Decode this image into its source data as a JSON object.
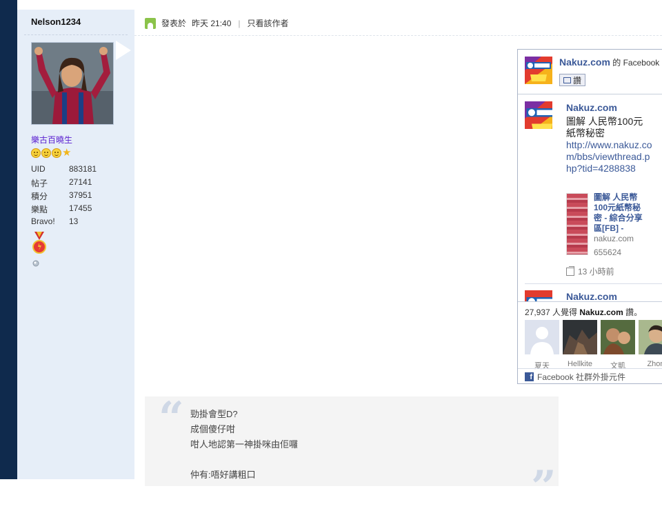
{
  "user": {
    "name": "Nelson1234",
    "group": "樂古百曉生",
    "stats": [
      {
        "label": "UID",
        "value": "883181"
      },
      {
        "label": "帖子",
        "value": "27141"
      },
      {
        "label": "積分",
        "value": "37951"
      },
      {
        "label": "樂點",
        "value": "17455"
      },
      {
        "label": "Bravo!",
        "value": "13"
      }
    ]
  },
  "post": {
    "posted_label": "發表於",
    "posted_time": "昨天 21:40",
    "only_author": "只看該作者"
  },
  "facebook": {
    "page_name": "Nakuz.com",
    "header_suffix": "的 Facebook",
    "like_button": "讚",
    "feed_name": "Nakuz.com",
    "feed_text": "圖解 人民幣100元紙幣秘密",
    "feed_link": "http://www.nakuz.com/bbs/viewthread.php?tid=4288838",
    "attachment_title": "圖解 人民幣100元紙幣秘密 - 綜合分享區[FB] -",
    "attachment_domain": "nakuz.com",
    "attachment_number": "655624",
    "feed_time": "13 小時前",
    "feed_name_2": "Nakuz.com",
    "likers_prefix": "27,937 人覺得",
    "likers_page": "Nakuz.com",
    "likers_suffix": "讚。",
    "faces": [
      "夏天",
      "Hellkite",
      "文凱",
      "Zhon"
    ],
    "footer": "Facebook 社群外掛元件"
  },
  "quote": {
    "lines": [
      "勁掛會型D?",
      "成個傻仔咁",
      "咁人地認第一神掛咪由佢囉",
      "",
      "仲有:唔好講粗口"
    ]
  }
}
